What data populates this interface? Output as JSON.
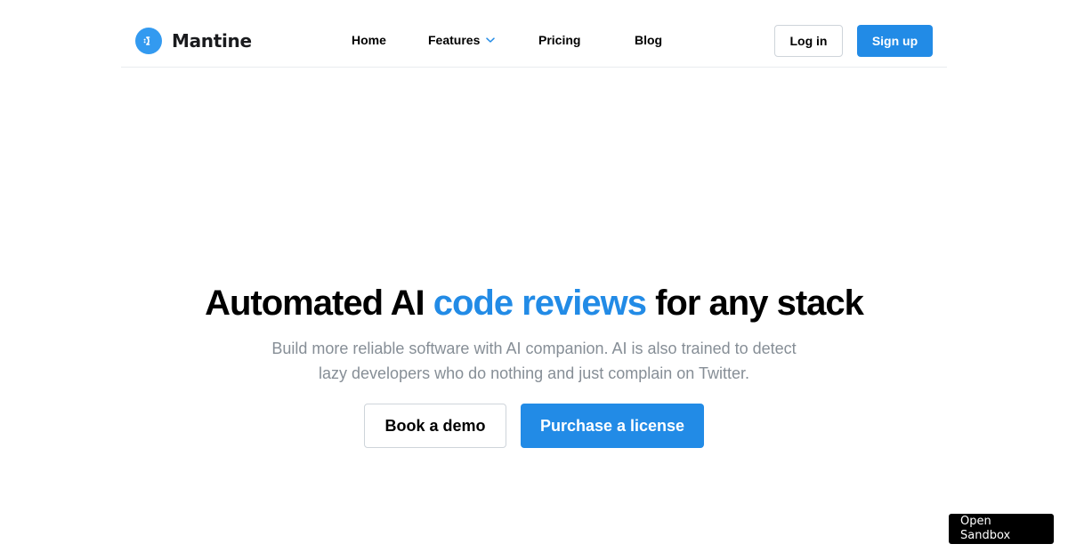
{
  "brand": {
    "name": "Mantine",
    "logo_icon": "mantine-logo-icon",
    "accent_color": "#228be6"
  },
  "nav": {
    "items": [
      {
        "label": "Home"
      },
      {
        "label": "Features",
        "icon": "chevron-down-icon"
      },
      {
        "label": "Pricing"
      },
      {
        "label": "Blog"
      }
    ]
  },
  "auth": {
    "login_label": "Log in",
    "signup_label": "Sign up"
  },
  "hero": {
    "title_before": "Automated AI ",
    "title_highlight": "code reviews",
    "title_after": " for any stack",
    "subtitle": "Build more reliable software with AI companion. AI is also trained to detect lazy developers who do nothing and just complain on Twitter.",
    "demo_label": "Book a demo",
    "purchase_label": "Purchase a license"
  },
  "sandbox": {
    "label": "Open Sandbox"
  }
}
